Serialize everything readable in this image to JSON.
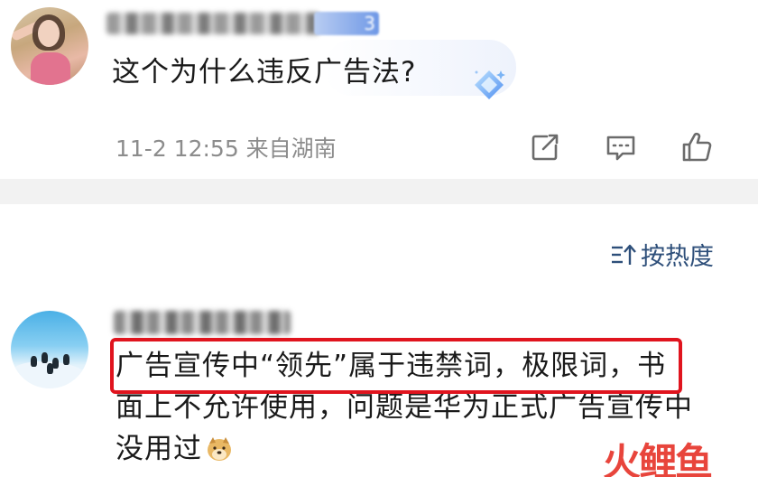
{
  "first_comment": {
    "badge_text": "3",
    "text": "这个为什么违反广告法?",
    "meta": "11-2 12:55 来自湖南",
    "actions": {
      "share_icon": "share-icon",
      "comment_icon": "comment-icon",
      "like_icon": "thumbs-up-icon"
    }
  },
  "sort": {
    "label": "按热度",
    "icon": "sort-icon"
  },
  "second_comment": {
    "lines": [
      "广告宣传中“领先”属于违禁词，极限词，书",
      "面上不允许使用，问题是华为正式广告宣传中",
      "没用过"
    ],
    "emoji": "doge-emoji"
  },
  "watermark": {
    "text": "火鲤鱼"
  },
  "colors": {
    "highlight_border": "#e0141e",
    "meta_gray": "#8c8c8c",
    "sort_blue": "#2e4f7a",
    "watermark_red": "#e8453c"
  }
}
